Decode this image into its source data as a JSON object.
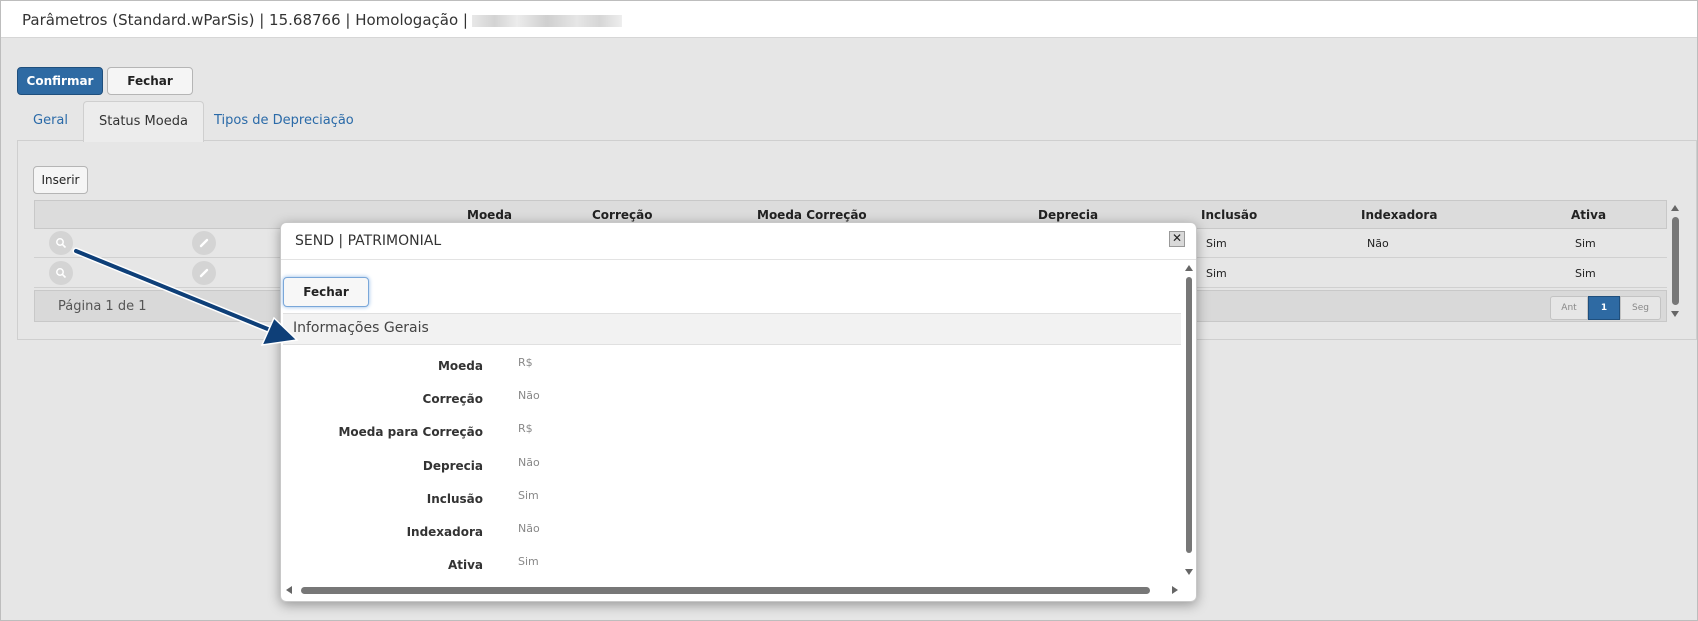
{
  "window": {
    "title": "Parâmetros (Standard.wParSis) | 15.68766 | Homologação |"
  },
  "toolbar": {
    "confirm_label": "Confirmar",
    "close_label": "Fechar"
  },
  "tabs": [
    {
      "label": "Geral"
    },
    {
      "label": "Status Moeda"
    },
    {
      "label": "Tipos de Depreciação"
    }
  ],
  "grid": {
    "insert_label": "Inserir",
    "columns": [
      "Moeda",
      "Correção",
      "Moeda Correção",
      "Deprecia",
      "Inclusão",
      "Indexadora",
      "Ativa"
    ],
    "rows": [
      {
        "inclusao": "Sim",
        "indexadora": "Não",
        "ativa": "Sim"
      },
      {
        "inclusao": "Sim",
        "indexadora": "",
        "ativa": "Sim"
      }
    ],
    "icons": {
      "view": "magnifier-icon",
      "edit": "pencil-icon"
    }
  },
  "pager": {
    "info": "Página 1 de 1",
    "prev_label": "Ant",
    "page": "1",
    "next_label": "Seg"
  },
  "modal": {
    "title": "SEND | PATRIMONIAL",
    "close_label": "Fechar",
    "section_title": "Informações Gerais",
    "fields": [
      {
        "label": "Moeda",
        "value": "R$"
      },
      {
        "label": "Correção",
        "value": "Não"
      },
      {
        "label": "Moeda para Correção",
        "value": "R$"
      },
      {
        "label": "Deprecia",
        "value": "Não"
      },
      {
        "label": "Inclusão",
        "value": "Sim"
      },
      {
        "label": "Indexadora",
        "value": "Não"
      },
      {
        "label": "Ativa",
        "value": "Sim"
      }
    ]
  },
  "colors": {
    "primary": "#2e6aa3",
    "link": "#2a6aa8",
    "annotation_arrow": "#0e3f78"
  }
}
